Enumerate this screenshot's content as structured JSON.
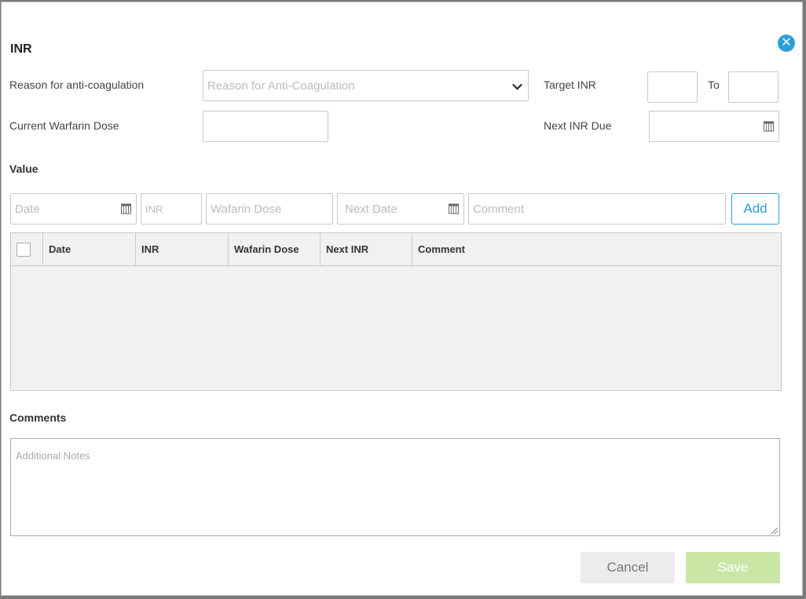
{
  "dialog": {
    "title": "INR",
    "close_icon": "close-icon"
  },
  "form": {
    "reason_label": "Reason for anti-coagulation",
    "reason_placeholder": "Reason for Anti-Coagulation",
    "target_label": "Target INR",
    "to_label": "To",
    "dose_label": "Current Warfarin Dose",
    "next_due_label": "Next INR Due"
  },
  "value_section": {
    "heading": "Value",
    "date_placeholder": "Date",
    "inr_placeholder": "INR",
    "dose_placeholder": "Wafarin Dose",
    "next_date_placeholder": "Next Date",
    "comment_placeholder": "Comment",
    "add_label": "Add"
  },
  "table": {
    "columns": [
      "Date",
      "INR",
      "Wafarin Dose",
      "Next INR",
      "Comment"
    ],
    "rows": []
  },
  "comments": {
    "heading": "Comments",
    "placeholder": "Additional Notes"
  },
  "footer": {
    "cancel_label": "Cancel",
    "save_label": "Save"
  },
  "colors": {
    "accent": "#2a9fd6",
    "save_disabled": "#c9e6a4"
  }
}
